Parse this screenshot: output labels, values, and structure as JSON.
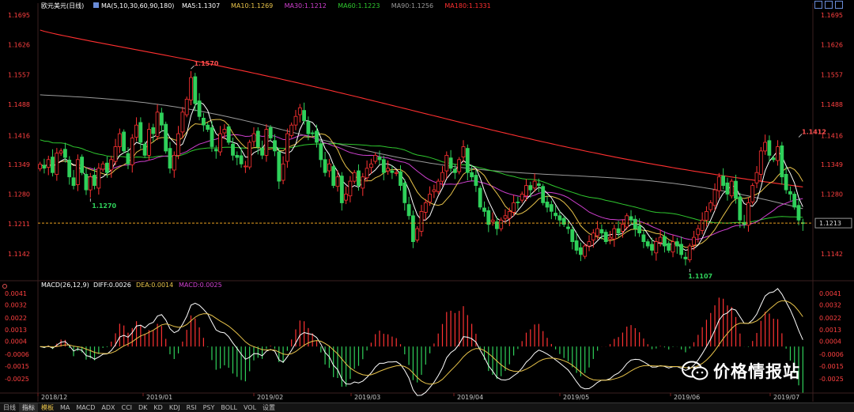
{
  "header": {
    "title": "欧元美元(日线)",
    "ma_label": "MA(5,10,30,60,90,180)",
    "ma_values": [
      {
        "text": "MA5:1.1307",
        "color": "#ffffff"
      },
      {
        "text": "MA10:1.1269",
        "color": "#e8c34a"
      },
      {
        "text": "MA30:1.1212",
        "color": "#d040d0"
      },
      {
        "text": "MA60:1.1223",
        "color": "#2fc82f"
      },
      {
        "text": "MA90:1.1256",
        "color": "#9a9a9a"
      },
      {
        "text": "MA180:1.1331",
        "color": "#ff3030"
      }
    ]
  },
  "macd_header": {
    "label": "MACD(26,12,9)",
    "diff": "DIFF:0.0026",
    "dea": "DEA:0.0014",
    "macd": "MACD:0.0025"
  },
  "current_price_tag": "1.1213",
  "watermark": "价格情报站",
  "bottom_tabs": [
    "日线",
    "指标",
    "模板",
    "MA",
    "MACD",
    "ADX",
    "CCI",
    "DK",
    "KD",
    "KDJ",
    "RSI",
    "PSY",
    "BOLL",
    "VOL",
    "设置"
  ],
  "colors": {
    "up": "#ff3232",
    "down": "#2fd05a",
    "ma5": "#ffffff",
    "ma10": "#e8c34a",
    "ma30": "#d040d0",
    "ma60": "#2fc82f",
    "ma90": "#9a9a9a",
    "ma180": "#ff3030"
  },
  "chart_data": [
    {
      "type": "candlestick",
      "title": "欧元美元(日线)",
      "y_ticks": [
        1.1695,
        1.1626,
        1.1557,
        1.1488,
        1.1416,
        1.1349,
        1.128,
        1.1211,
        1.1142
      ],
      "ylim": [
        1.1085,
        1.1715
      ],
      "x_ticks": [
        "2018/12",
        "2019/01",
        "2019/02",
        "2019/03",
        "2019/04",
        "2019/05",
        "2019/06",
        "2019/07"
      ],
      "annotations": [
        {
          "text": "1.1570",
          "value": 1.157
        },
        {
          "text": "1.1270",
          "value": 1.127
        },
        {
          "text": "1.1107",
          "value": 1.1107
        },
        {
          "text": "1.1412",
          "value": 1.1412
        }
      ],
      "current_price": 1.1213,
      "closes": [
        1.1349,
        1.134,
        1.136,
        1.133,
        1.1375,
        1.138,
        1.1365,
        1.132,
        1.13,
        1.136,
        1.133,
        1.129,
        1.132,
        1.13,
        1.134,
        1.135,
        1.133,
        1.136,
        1.139,
        1.142,
        1.138,
        1.135,
        1.141,
        1.144,
        1.14,
        1.137,
        1.143,
        1.142,
        1.147,
        1.144,
        1.138,
        1.134,
        1.137,
        1.142,
        1.147,
        1.15,
        1.155,
        1.149,
        1.146,
        1.144,
        1.143,
        1.139,
        1.138,
        1.142,
        1.143,
        1.14,
        1.137,
        1.1365,
        1.135,
        1.1345,
        1.14,
        1.142,
        1.139,
        1.137,
        1.143,
        1.141,
        1.138,
        1.131,
        1.135,
        1.142,
        1.144,
        1.146,
        1.148,
        1.145,
        1.142,
        1.142,
        1.14,
        1.136,
        1.133,
        1.135,
        1.13,
        1.132,
        1.126,
        1.128,
        1.131,
        1.133,
        1.13,
        1.132,
        1.134,
        1.135,
        1.137,
        1.136,
        1.133,
        1.134,
        1.133,
        1.133,
        1.13,
        1.126,
        1.123,
        1.117,
        1.12,
        1.124,
        1.126,
        1.128,
        1.129,
        1.131,
        1.133,
        1.137,
        1.134,
        1.133,
        1.136,
        1.139,
        1.133,
        1.132,
        1.13,
        1.125,
        1.124,
        1.121,
        1.122,
        1.12,
        1.122,
        1.123,
        1.124,
        1.126,
        1.126,
        1.128,
        1.13,
        1.129,
        1.131,
        1.13,
        1.126,
        1.125,
        1.124,
        1.123,
        1.122,
        1.121,
        1.12,
        1.117,
        1.115,
        1.114,
        1.116,
        1.117,
        1.119,
        1.12,
        1.119,
        1.117,
        1.118,
        1.12,
        1.119,
        1.121,
        1.123,
        1.122,
        1.12,
        1.119,
        1.117,
        1.116,
        1.115,
        1.117,
        1.118,
        1.116,
        1.115,
        1.117,
        1.116,
        1.114,
        1.113,
        1.116,
        1.118,
        1.12,
        1.122,
        1.124,
        1.126,
        1.129,
        1.132,
        1.13,
        1.128,
        1.131,
        1.127,
        1.122,
        1.121,
        1.126,
        1.13,
        1.133,
        1.138,
        1.14,
        1.137,
        1.136,
        1.139,
        1.132,
        1.129,
        1.128,
        1.125,
        1.122,
        1.1213
      ]
    },
    {
      "type": "macd",
      "title": "MACD(26,12,9)",
      "y_ticks": [
        0.0041,
        0.0032,
        0.0022,
        0.0013,
        0.0004,
        -0.0006,
        -0.0015,
        -0.0025
      ],
      "ylim": [
        -0.0034,
        0.0044
      ],
      "series": [
        {
          "name": "DIFF",
          "color": "#ffffff"
        },
        {
          "name": "DEA",
          "color": "#e8c34a"
        },
        {
          "name": "MACD",
          "color": "#d040d0"
        }
      ]
    }
  ]
}
